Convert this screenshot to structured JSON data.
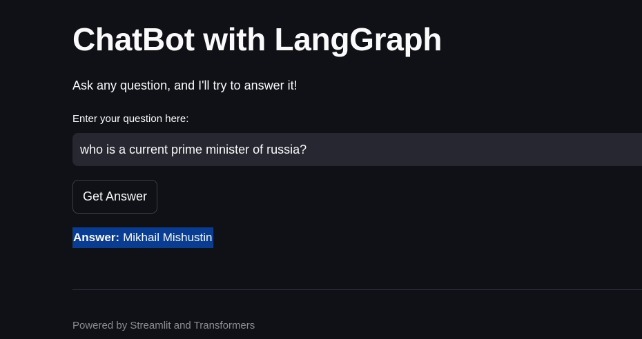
{
  "app": {
    "title": "ChatBot with LangGraph",
    "subtitle": "Ask any question, and I'll try to answer it!"
  },
  "question_input": {
    "label": "Enter your question here:",
    "value": "who is a current prime minister of russia?"
  },
  "actions": {
    "get_answer_label": "Get Answer"
  },
  "answer": {
    "prefix": "Answer:",
    "text": "Mikhail Mishustin"
  },
  "footer": {
    "text": "Powered by Streamlit and Transformers"
  },
  "colors": {
    "background": "#0f1117",
    "input_background": "#262730",
    "selection_highlight": "#0a3d91",
    "text": "#fafafa",
    "muted_text": "#8b8d93"
  }
}
